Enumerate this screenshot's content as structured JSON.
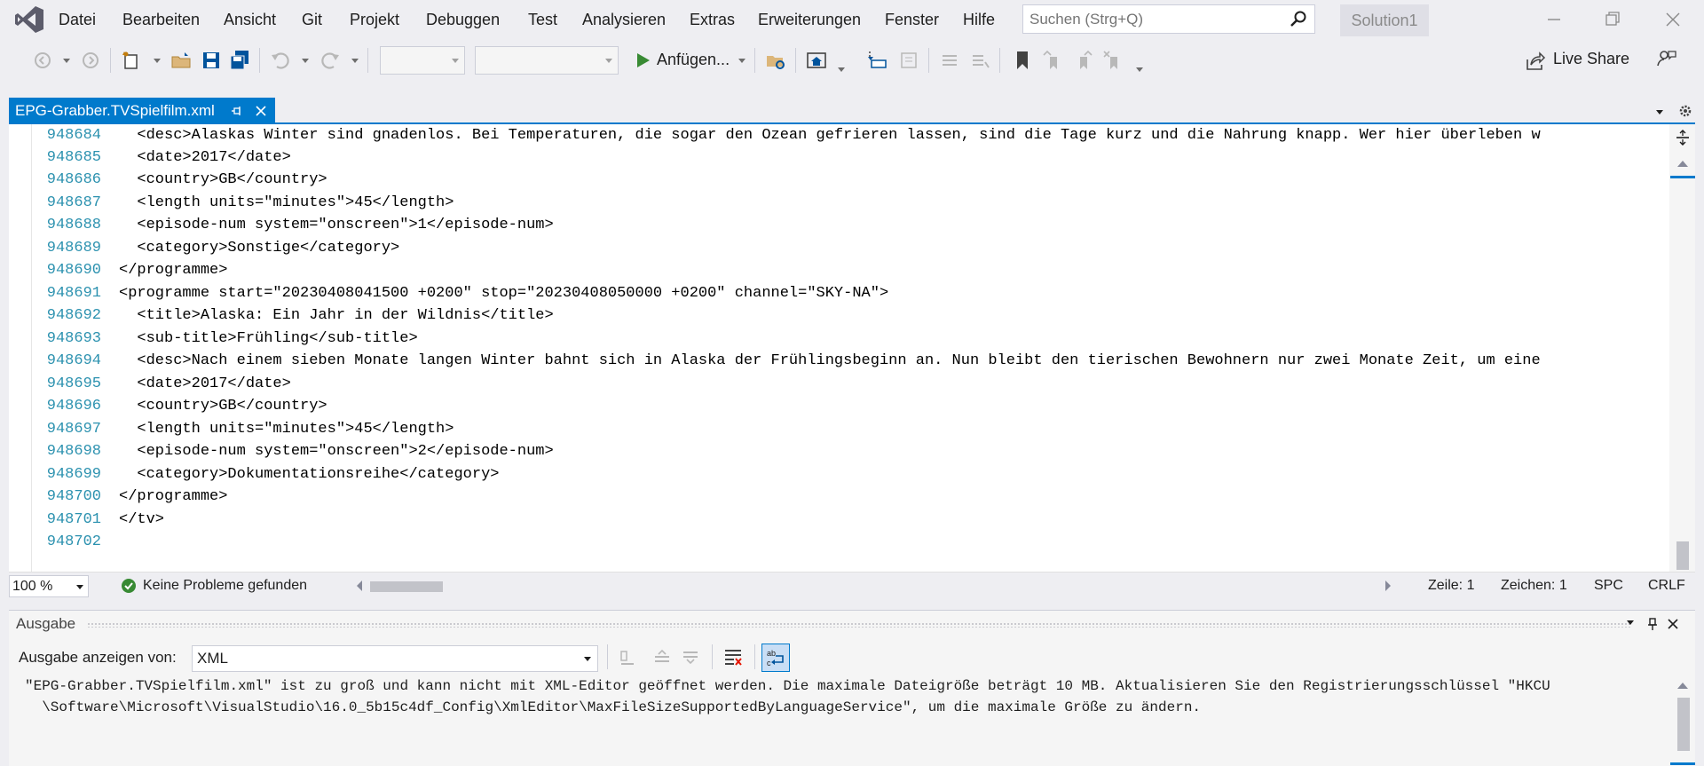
{
  "menu": {
    "items": [
      "Datei",
      "Bearbeiten",
      "Ansicht",
      "Git",
      "Projekt",
      "Debuggen",
      "Test",
      "Analysieren",
      "Extras",
      "Erweiterungen",
      "Fenster",
      "Hilfe"
    ]
  },
  "search": {
    "placeholder": "Suchen (Strg+Q)"
  },
  "solution": {
    "name": "Solution1"
  },
  "toolbar": {
    "attach_label": "Anfügen...",
    "liveshare_label": "Live Share"
  },
  "tab": {
    "title": "EPG-Grabber.TVSpielfilm.xml"
  },
  "editor": {
    "lines": [
      {
        "num": "948684",
        "text": "  <desc>Alaskas Winter sind gnadenlos. Bei Temperaturen, die sogar den Ozean gefrieren lassen, sind die Tage kurz und die Nahrung knapp. Wer hier überleben w"
      },
      {
        "num": "948685",
        "text": "  <date>2017</date>"
      },
      {
        "num": "948686",
        "text": "  <country>GB</country>"
      },
      {
        "num": "948687",
        "text": "  <length units=\"minutes\">45</length>"
      },
      {
        "num": "948688",
        "text": "  <episode-num system=\"onscreen\">1</episode-num>"
      },
      {
        "num": "948689",
        "text": "  <category>Sonstige</category>"
      },
      {
        "num": "948690",
        "text": "</programme>"
      },
      {
        "num": "948691",
        "text": "<programme start=\"20230408041500 +0200\" stop=\"20230408050000 +0200\" channel=\"SKY-NA\">"
      },
      {
        "num": "948692",
        "text": "  <title>Alaska: Ein Jahr in der Wildnis</title>"
      },
      {
        "num": "948693",
        "text": "  <sub-title>Frühling</sub-title>"
      },
      {
        "num": "948694",
        "text": "  <desc>Nach einem sieben Monate langen Winter bahnt sich in Alaska der Frühlingsbeginn an. Nun bleibt den tierischen Bewohnern nur zwei Monate Zeit, um eine"
      },
      {
        "num": "948695",
        "text": "  <date>2017</date>"
      },
      {
        "num": "948696",
        "text": "  <country>GB</country>"
      },
      {
        "num": "948697",
        "text": "  <length units=\"minutes\">45</length>"
      },
      {
        "num": "948698",
        "text": "  <episode-num system=\"onscreen\">2</episode-num>"
      },
      {
        "num": "948699",
        "text": "  <category>Dokumentationsreihe</category>"
      },
      {
        "num": "948700",
        "text": "</programme>"
      },
      {
        "num": "948701",
        "text": "</tv>"
      },
      {
        "num": "948702",
        "text": ""
      }
    ]
  },
  "statusbar": {
    "zoom": "100 %",
    "issues": "Keine Probleme gefunden",
    "line": "Zeile: 1",
    "char": "Zeichen: 1",
    "spacing": "SPC",
    "line_ending": "CRLF"
  },
  "output": {
    "title": "Ausgabe",
    "show_from_label": "Ausgabe anzeigen von:",
    "source": "XML",
    "message_line1": "\"EPG-Grabber.TVSpielfilm.xml\" ist zu groß und kann nicht mit XML-Editor geöffnet werden. Die maximale Dateigröße beträgt 10 MB. Aktualisieren Sie den Registrierungsschlüssel \"HKCU",
    "message_line2": "  \\Software\\Microsoft\\VisualStudio\\16.0_5b15c4df_Config\\XmlEditor\\MaxFileSizeSupportedByLanguageService\", um die maximale Größe zu ändern."
  },
  "colors": {
    "accent": "#007acc",
    "line_number": "#2b91af",
    "ok_green": "#388a34",
    "bookmark": "#424242"
  }
}
